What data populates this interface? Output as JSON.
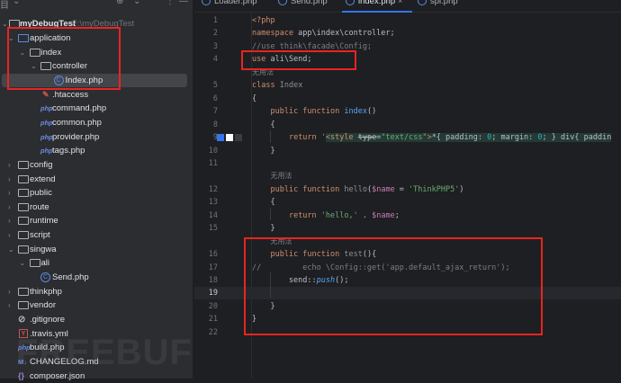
{
  "project": {
    "title_fragment": "目",
    "name": "myDebugTest",
    "path": "F:\\myDebugTest"
  },
  "tree": [
    {
      "label": "application",
      "type": "folder",
      "depth": 1,
      "open": true,
      "blue": true
    },
    {
      "label": "index",
      "type": "folder",
      "depth": 2,
      "open": true
    },
    {
      "label": "controller",
      "type": "folder",
      "depth": 3,
      "open": true
    },
    {
      "label": "Index.php",
      "type": "class",
      "depth": 4,
      "selected": true
    },
    {
      "label": ".htaccess",
      "type": "htaccess",
      "depth": 3
    },
    {
      "label": "command.php",
      "type": "php",
      "depth": 3
    },
    {
      "label": "common.php",
      "type": "php",
      "depth": 3
    },
    {
      "label": "provider.php",
      "type": "php",
      "depth": 3
    },
    {
      "label": "tags.php",
      "type": "php",
      "depth": 3
    },
    {
      "label": "config",
      "type": "folder",
      "depth": 1
    },
    {
      "label": "extend",
      "type": "folder",
      "depth": 1
    },
    {
      "label": "public",
      "type": "folder",
      "depth": 1
    },
    {
      "label": "route",
      "type": "folder",
      "depth": 1
    },
    {
      "label": "runtime",
      "type": "folder",
      "depth": 1
    },
    {
      "label": "script",
      "type": "folder",
      "depth": 1
    },
    {
      "label": "singwa",
      "type": "folder",
      "depth": 1,
      "open": true
    },
    {
      "label": "ali",
      "type": "folder",
      "depth": 2,
      "open": true
    },
    {
      "label": "Send.php",
      "type": "class",
      "depth": 3
    },
    {
      "label": "thinkphp",
      "type": "folder",
      "depth": 1
    },
    {
      "label": "vendor",
      "type": "folder",
      "depth": 1
    },
    {
      "label": ".gitignore",
      "type": "ignore",
      "depth": 1
    },
    {
      "label": ".travis.yml",
      "type": "yml",
      "depth": 1
    },
    {
      "label": "build.php",
      "type": "php",
      "depth": 1
    },
    {
      "label": "CHANGELOG.md",
      "type": "md",
      "depth": 1
    },
    {
      "label": "composer.json",
      "type": "json",
      "depth": 1
    }
  ],
  "icons": {
    "php": "php",
    "md": "M↓",
    "yml": "Y",
    "class": "C"
  },
  "tabs": [
    {
      "label": "Loader.php"
    },
    {
      "label": "Send.php"
    },
    {
      "label": "index.php",
      "active": true,
      "close": "×"
    },
    {
      "label": "spl.php"
    }
  ],
  "hint_text": "无用法",
  "watermark": "FREEBUF",
  "lines": [
    {
      "n": "1",
      "html": "<span class='kw'>&lt;?php</span>"
    },
    {
      "n": "2",
      "html": "<span class='kw'>namespace</span> app\\index\\controller;"
    },
    {
      "n": "3",
      "html": "<span class='cm'>//use think\\facade\\Config;</span>"
    },
    {
      "n": "4",
      "html": "<span class='kw'>use</span> ali\\Send;"
    },
    {
      "hint": true,
      "indent": 0
    },
    {
      "n": "5",
      "html": "<span class='kw'>class</span> <span class='gr'>Index</span>"
    },
    {
      "n": "6",
      "html": "{"
    },
    {
      "n": "7",
      "html": "    <span class='kw'>public function</span> <span class='fn'>index</span>()"
    },
    {
      "n": "8",
      "html": "    {"
    },
    {
      "n": "9",
      "html": "        <span class='kw'>return</span> <span class='str'>'</span><span class='inj'><span class='kw'>&lt;style</span> <span class='strk'>type</span>=<span class='str'>\"text/css\"</span><span class='kw'>&gt;</span>*{ padding: <span class='num'>0</span>; margin: <span class='num'>0</span>; } div{ paddin</span>"
    },
    {
      "n": "10",
      "html": "    }"
    },
    {
      "n": "11",
      "html": ""
    },
    {
      "hint": true,
      "indent": 4
    },
    {
      "n": "12",
      "html": "    <span class='kw'>public function</span> <span class='gr'>hello</span>(<span class='var'>$name</span> = <span class='str'>'ThinkPHP5'</span>)"
    },
    {
      "n": "13",
      "html": "    {"
    },
    {
      "n": "14",
      "html": "        <span class='kw'>return</span> <span class='str'>'hello,'</span> . <span class='var'>$name</span>;"
    },
    {
      "n": "15",
      "html": "    }"
    },
    {
      "hint": true,
      "indent": 4
    },
    {
      "n": "16",
      "html": "    <span class='kw'>public function</span> <span class='gr'>test</span>(){"
    },
    {
      "n": "17",
      "html": "<span class='cm'>//         echo \\Config::get('app.default_ajax_return');</span>"
    },
    {
      "n": "18",
      "html": "        send::<span class='it'>push</span>();"
    },
    {
      "n": "19",
      "html": "",
      "current": true
    },
    {
      "n": "20",
      "html": "    }"
    },
    {
      "n": "21",
      "html": "}"
    },
    {
      "n": "22",
      "html": ""
    }
  ]
}
